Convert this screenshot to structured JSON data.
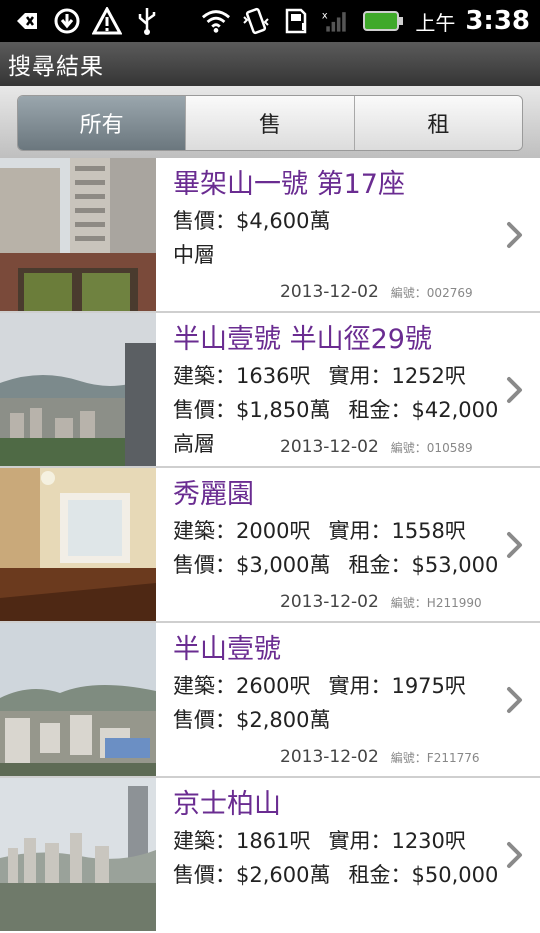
{
  "statusbar": {
    "ampm": "上午",
    "time": "3:38"
  },
  "titlebar": {
    "title": "搜尋結果"
  },
  "tabs": [
    {
      "label": "所有",
      "active": true
    },
    {
      "label": "售",
      "active": false
    },
    {
      "label": "租",
      "active": false
    }
  ],
  "listings": [
    {
      "title": "畢架山一號 第17座",
      "line1": "售價：$4,600萬",
      "line2": "中層",
      "date": "2013-12-02",
      "code": "編號：002769"
    },
    {
      "title": "半山壹號 半山徑29號",
      "line1a": "建築：1636呎",
      "line1b": "實用：1252呎",
      "line2a": "售價：$1,850萬",
      "line2b": "租金：$42,000",
      "line3": "高層",
      "date": "2013-12-02",
      "code": "編號：010589"
    },
    {
      "title": "秀麗園",
      "line1a": "建築：2000呎",
      "line1b": "實用：1558呎",
      "line2a": "售價：$3,000萬",
      "line2b": "租金：$53,000",
      "date": "2013-12-02",
      "code": "編號：H211990"
    },
    {
      "title": "半山壹號",
      "line1a": "建築：2600呎",
      "line1b": "實用：1975呎",
      "line2a": "售價：$2,800萬",
      "date": "2013-12-02",
      "code": "編號：F211776"
    },
    {
      "title": "京士柏山",
      "line1a": "建築：1861呎",
      "line1b": "實用：1230呎",
      "line2a": "售價：$2,600萬",
      "line2b": "租金：$50,000"
    }
  ]
}
